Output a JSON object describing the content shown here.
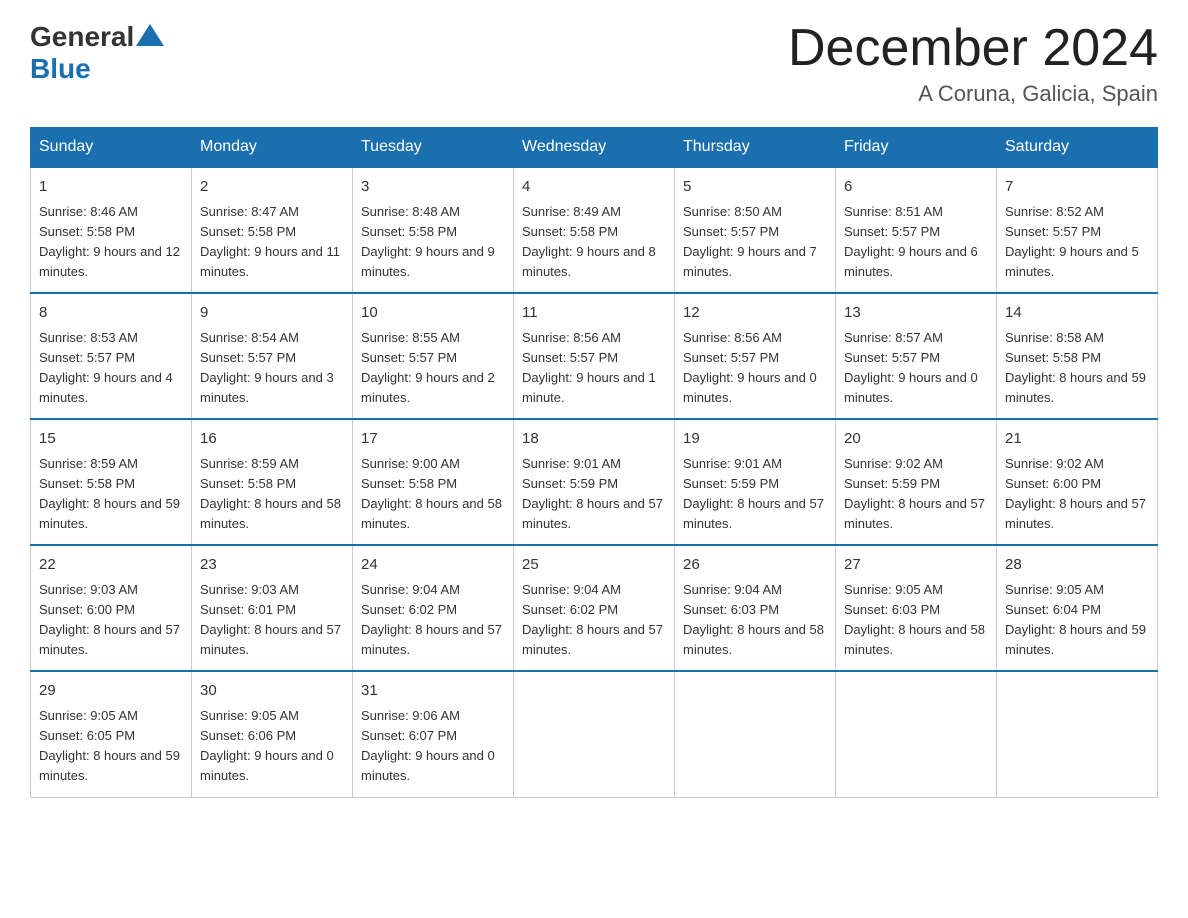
{
  "header": {
    "logo_general": "General",
    "logo_blue": "Blue",
    "title": "December 2024",
    "subtitle": "A Coruna, Galicia, Spain"
  },
  "weekdays": [
    "Sunday",
    "Monday",
    "Tuesday",
    "Wednesday",
    "Thursday",
    "Friday",
    "Saturday"
  ],
  "weeks": [
    [
      {
        "day": "1",
        "sunrise": "8:46 AM",
        "sunset": "5:58 PM",
        "daylight": "9 hours and 12 minutes."
      },
      {
        "day": "2",
        "sunrise": "8:47 AM",
        "sunset": "5:58 PM",
        "daylight": "9 hours and 11 minutes."
      },
      {
        "day": "3",
        "sunrise": "8:48 AM",
        "sunset": "5:58 PM",
        "daylight": "9 hours and 9 minutes."
      },
      {
        "day": "4",
        "sunrise": "8:49 AM",
        "sunset": "5:58 PM",
        "daylight": "9 hours and 8 minutes."
      },
      {
        "day": "5",
        "sunrise": "8:50 AM",
        "sunset": "5:57 PM",
        "daylight": "9 hours and 7 minutes."
      },
      {
        "day": "6",
        "sunrise": "8:51 AM",
        "sunset": "5:57 PM",
        "daylight": "9 hours and 6 minutes."
      },
      {
        "day": "7",
        "sunrise": "8:52 AM",
        "sunset": "5:57 PM",
        "daylight": "9 hours and 5 minutes."
      }
    ],
    [
      {
        "day": "8",
        "sunrise": "8:53 AM",
        "sunset": "5:57 PM",
        "daylight": "9 hours and 4 minutes."
      },
      {
        "day": "9",
        "sunrise": "8:54 AM",
        "sunset": "5:57 PM",
        "daylight": "9 hours and 3 minutes."
      },
      {
        "day": "10",
        "sunrise": "8:55 AM",
        "sunset": "5:57 PM",
        "daylight": "9 hours and 2 minutes."
      },
      {
        "day": "11",
        "sunrise": "8:56 AM",
        "sunset": "5:57 PM",
        "daylight": "9 hours and 1 minute."
      },
      {
        "day": "12",
        "sunrise": "8:56 AM",
        "sunset": "5:57 PM",
        "daylight": "9 hours and 0 minutes."
      },
      {
        "day": "13",
        "sunrise": "8:57 AM",
        "sunset": "5:57 PM",
        "daylight": "9 hours and 0 minutes."
      },
      {
        "day": "14",
        "sunrise": "8:58 AM",
        "sunset": "5:58 PM",
        "daylight": "8 hours and 59 minutes."
      }
    ],
    [
      {
        "day": "15",
        "sunrise": "8:59 AM",
        "sunset": "5:58 PM",
        "daylight": "8 hours and 59 minutes."
      },
      {
        "day": "16",
        "sunrise": "8:59 AM",
        "sunset": "5:58 PM",
        "daylight": "8 hours and 58 minutes."
      },
      {
        "day": "17",
        "sunrise": "9:00 AM",
        "sunset": "5:58 PM",
        "daylight": "8 hours and 58 minutes."
      },
      {
        "day": "18",
        "sunrise": "9:01 AM",
        "sunset": "5:59 PM",
        "daylight": "8 hours and 57 minutes."
      },
      {
        "day": "19",
        "sunrise": "9:01 AM",
        "sunset": "5:59 PM",
        "daylight": "8 hours and 57 minutes."
      },
      {
        "day": "20",
        "sunrise": "9:02 AM",
        "sunset": "5:59 PM",
        "daylight": "8 hours and 57 minutes."
      },
      {
        "day": "21",
        "sunrise": "9:02 AM",
        "sunset": "6:00 PM",
        "daylight": "8 hours and 57 minutes."
      }
    ],
    [
      {
        "day": "22",
        "sunrise": "9:03 AM",
        "sunset": "6:00 PM",
        "daylight": "8 hours and 57 minutes."
      },
      {
        "day": "23",
        "sunrise": "9:03 AM",
        "sunset": "6:01 PM",
        "daylight": "8 hours and 57 minutes."
      },
      {
        "day": "24",
        "sunrise": "9:04 AM",
        "sunset": "6:02 PM",
        "daylight": "8 hours and 57 minutes."
      },
      {
        "day": "25",
        "sunrise": "9:04 AM",
        "sunset": "6:02 PM",
        "daylight": "8 hours and 57 minutes."
      },
      {
        "day": "26",
        "sunrise": "9:04 AM",
        "sunset": "6:03 PM",
        "daylight": "8 hours and 58 minutes."
      },
      {
        "day": "27",
        "sunrise": "9:05 AM",
        "sunset": "6:03 PM",
        "daylight": "8 hours and 58 minutes."
      },
      {
        "day": "28",
        "sunrise": "9:05 AM",
        "sunset": "6:04 PM",
        "daylight": "8 hours and 59 minutes."
      }
    ],
    [
      {
        "day": "29",
        "sunrise": "9:05 AM",
        "sunset": "6:05 PM",
        "daylight": "8 hours and 59 minutes."
      },
      {
        "day": "30",
        "sunrise": "9:05 AM",
        "sunset": "6:06 PM",
        "daylight": "9 hours and 0 minutes."
      },
      {
        "day": "31",
        "sunrise": "9:06 AM",
        "sunset": "6:07 PM",
        "daylight": "9 hours and 0 minutes."
      },
      null,
      null,
      null,
      null
    ]
  ]
}
